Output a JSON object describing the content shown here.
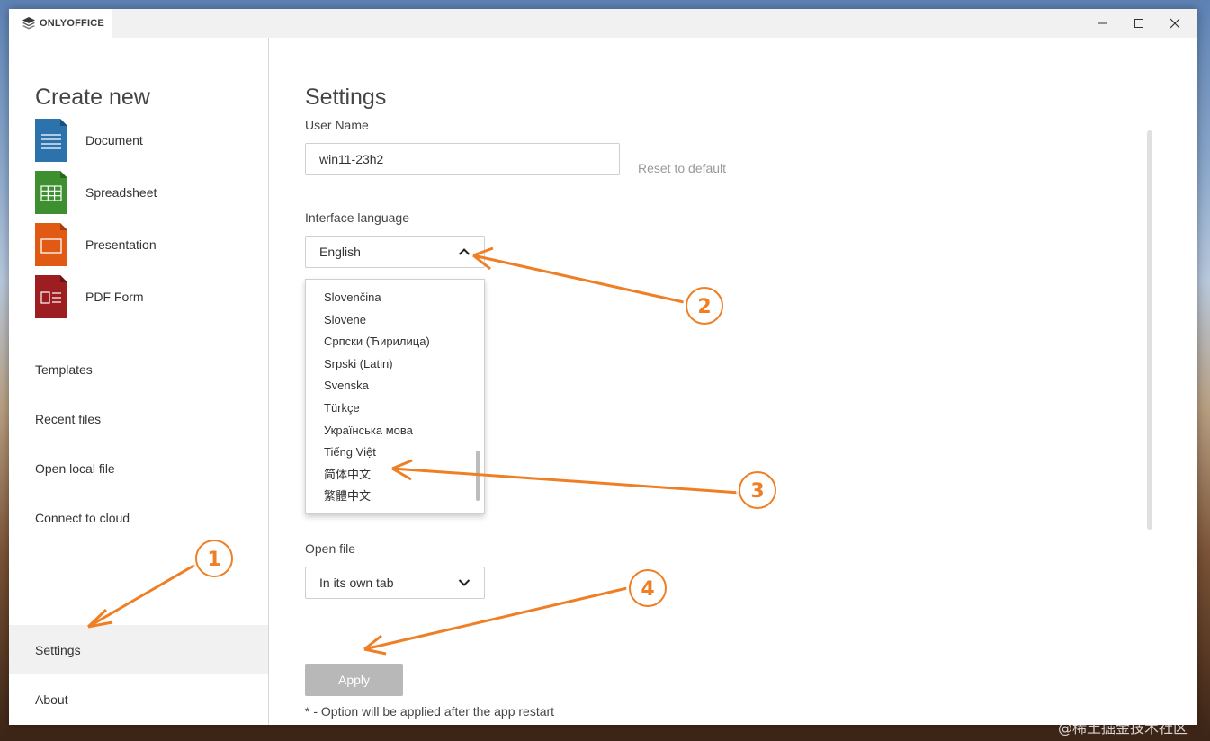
{
  "app": {
    "brand": "ONLYOFFICE"
  },
  "window_controls": {
    "minimize": "minimize",
    "maximize": "maximize",
    "close": "close"
  },
  "sidebar": {
    "create_title": "Create new",
    "create_items": [
      {
        "label": "Document",
        "icon": "document-icon",
        "color": "#2c73ad"
      },
      {
        "label": "Spreadsheet",
        "icon": "spreadsheet-icon",
        "color": "#3d8f2f"
      },
      {
        "label": "Presentation",
        "icon": "presentation-icon",
        "color": "#e05a14"
      },
      {
        "label": "PDF Form",
        "icon": "pdf-form-icon",
        "color": "#9d1e21"
      }
    ],
    "nav_items": [
      {
        "label": "Templates"
      },
      {
        "label": "Recent files"
      },
      {
        "label": "Open local file"
      },
      {
        "label": "Connect to cloud"
      },
      {
        "label": "Settings",
        "active": true
      },
      {
        "label": "About"
      }
    ]
  },
  "settings": {
    "title": "Settings",
    "user_name_label": "User Name",
    "user_name_value": "win11-23h2",
    "reset_link": "Reset to default",
    "interface_language_label": "Interface language",
    "interface_language_value": "English",
    "language_options": [
      "Slovenčina",
      "Slovene",
      "Српски (Ћирилица)",
      "Srpski (Latin)",
      "Svenska",
      "Türkçe",
      "Українська мова",
      "Tiếng Việt",
      "简体中文",
      "繁體中文"
    ],
    "open_file_label": "Open file",
    "open_file_value": "In its own tab",
    "apply_label": "Apply",
    "restart_note": "* - Option will be applied after the app restart"
  },
  "annotations": {
    "badges": [
      "1",
      "2",
      "3",
      "4"
    ],
    "color": "#ee7f25"
  },
  "watermark": "@稀土掘金技术社区"
}
